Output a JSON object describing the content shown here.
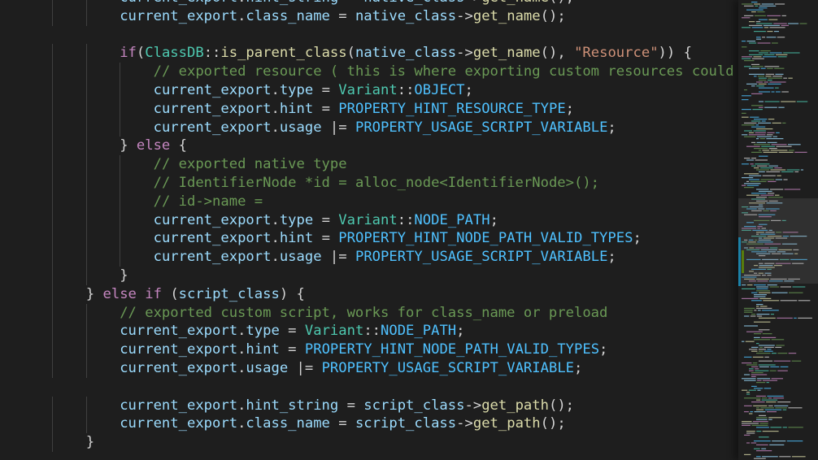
{
  "editor": {
    "language": "cpp",
    "colors": {
      "background": "#1e1e1e",
      "text": "#d4d4d4",
      "identifier": "#9cdcfe",
      "keyword": "#c586c0",
      "type": "#4ec9b0",
      "constant": "#4fc1ff",
      "function": "#dcdcaa",
      "string": "#ce9178",
      "comment": "#6a9955",
      "indent_guide": "#404040",
      "git_modified": "#1b81a8",
      "git_added": "#587c0c"
    },
    "lines": [
      {
        "indent": 3,
        "tokens": [
          {
            "t": "current_export",
            "c": "identifier"
          },
          {
            "t": ".",
            "c": "text"
          },
          {
            "t": "hint_string",
            "c": "identifier"
          },
          {
            "t": " = ",
            "c": "text"
          },
          {
            "t": "native_class",
            "c": "identifier"
          },
          {
            "t": "->",
            "c": "text"
          },
          {
            "t": "get_name",
            "c": "function"
          },
          {
            "t": "();",
            "c": "text"
          }
        ]
      },
      {
        "indent": 3,
        "tokens": [
          {
            "t": "current_export",
            "c": "identifier"
          },
          {
            "t": ".",
            "c": "text"
          },
          {
            "t": "class_name",
            "c": "identifier"
          },
          {
            "t": " = ",
            "c": "text"
          },
          {
            "t": "native_class",
            "c": "identifier"
          },
          {
            "t": "->",
            "c": "text"
          },
          {
            "t": "get_name",
            "c": "function"
          },
          {
            "t": "();",
            "c": "text"
          }
        ]
      },
      {
        "indent": 0,
        "tokens": []
      },
      {
        "indent": 3,
        "tokens": [
          {
            "t": "if",
            "c": "keyword"
          },
          {
            "t": "(",
            "c": "text"
          },
          {
            "t": "ClassDB",
            "c": "type"
          },
          {
            "t": "::",
            "c": "text"
          },
          {
            "t": "is_parent_class",
            "c": "function"
          },
          {
            "t": "(",
            "c": "text"
          },
          {
            "t": "native_class",
            "c": "identifier"
          },
          {
            "t": "->",
            "c": "text"
          },
          {
            "t": "get_name",
            "c": "function"
          },
          {
            "t": "(), ",
            "c": "text"
          },
          {
            "t": "\"Resource\"",
            "c": "string"
          },
          {
            "t": ")) {",
            "c": "text"
          }
        ]
      },
      {
        "indent": 4,
        "tokens": [
          {
            "t": "// exported resource ( this is where exporting custom resources could be",
            "c": "comment"
          }
        ]
      },
      {
        "indent": 4,
        "tokens": [
          {
            "t": "current_export",
            "c": "identifier"
          },
          {
            "t": ".",
            "c": "text"
          },
          {
            "t": "type",
            "c": "identifier"
          },
          {
            "t": " = ",
            "c": "text"
          },
          {
            "t": "Variant",
            "c": "type"
          },
          {
            "t": "::",
            "c": "text"
          },
          {
            "t": "OBJECT",
            "c": "constant"
          },
          {
            "t": ";",
            "c": "text"
          }
        ]
      },
      {
        "indent": 4,
        "tokens": [
          {
            "t": "current_export",
            "c": "identifier"
          },
          {
            "t": ".",
            "c": "text"
          },
          {
            "t": "hint",
            "c": "identifier"
          },
          {
            "t": " = ",
            "c": "text"
          },
          {
            "t": "PROPERTY_HINT_RESOURCE_TYPE",
            "c": "constant"
          },
          {
            "t": ";",
            "c": "text"
          }
        ]
      },
      {
        "indent": 4,
        "tokens": [
          {
            "t": "current_export",
            "c": "identifier"
          },
          {
            "t": ".",
            "c": "text"
          },
          {
            "t": "usage",
            "c": "identifier"
          },
          {
            "t": " |= ",
            "c": "text"
          },
          {
            "t": "PROPERTY_USAGE_SCRIPT_VARIABLE",
            "c": "constant"
          },
          {
            "t": ";",
            "c": "text"
          }
        ]
      },
      {
        "indent": 3,
        "tokens": [
          {
            "t": "} ",
            "c": "text"
          },
          {
            "t": "else",
            "c": "keyword"
          },
          {
            "t": " {",
            "c": "text"
          }
        ]
      },
      {
        "indent": 4,
        "tokens": [
          {
            "t": "// exported native type",
            "c": "comment"
          }
        ]
      },
      {
        "indent": 4,
        "tokens": [
          {
            "t": "// IdentifierNode *id = alloc_node<IdentifierNode>();",
            "c": "comment"
          }
        ]
      },
      {
        "indent": 4,
        "tokens": [
          {
            "t": "// id->name =",
            "c": "comment"
          }
        ]
      },
      {
        "indent": 4,
        "tokens": [
          {
            "t": "current_export",
            "c": "identifier"
          },
          {
            "t": ".",
            "c": "text"
          },
          {
            "t": "type",
            "c": "identifier"
          },
          {
            "t": " = ",
            "c": "text"
          },
          {
            "t": "Variant",
            "c": "type"
          },
          {
            "t": "::",
            "c": "text"
          },
          {
            "t": "NODE_PATH",
            "c": "constant"
          },
          {
            "t": ";",
            "c": "text"
          }
        ]
      },
      {
        "indent": 4,
        "tokens": [
          {
            "t": "current_export",
            "c": "identifier"
          },
          {
            "t": ".",
            "c": "text"
          },
          {
            "t": "hint",
            "c": "identifier"
          },
          {
            "t": " = ",
            "c": "text"
          },
          {
            "t": "PROPERTY_HINT_NODE_PATH_VALID_TYPES",
            "c": "constant"
          },
          {
            "t": ";",
            "c": "text"
          }
        ]
      },
      {
        "indent": 4,
        "tokens": [
          {
            "t": "current_export",
            "c": "identifier"
          },
          {
            "t": ".",
            "c": "text"
          },
          {
            "t": "usage",
            "c": "identifier"
          },
          {
            "t": " |= ",
            "c": "text"
          },
          {
            "t": "PROPERTY_USAGE_SCRIPT_VARIABLE",
            "c": "constant"
          },
          {
            "t": ";",
            "c": "text"
          }
        ]
      },
      {
        "indent": 3,
        "tokens": [
          {
            "t": "}",
            "c": "text"
          }
        ]
      },
      {
        "indent": 2,
        "tokens": [
          {
            "t": "} ",
            "c": "text"
          },
          {
            "t": "else",
            "c": "keyword"
          },
          {
            "t": " ",
            "c": "text"
          },
          {
            "t": "if",
            "c": "keyword"
          },
          {
            "t": " (",
            "c": "text"
          },
          {
            "t": "script_class",
            "c": "identifier"
          },
          {
            "t": ") {",
            "c": "text"
          }
        ]
      },
      {
        "indent": 3,
        "tokens": [
          {
            "t": "// exported custom script, works for class_name or preload",
            "c": "comment"
          }
        ]
      },
      {
        "indent": 3,
        "tokens": [
          {
            "t": "current_export",
            "c": "identifier"
          },
          {
            "t": ".",
            "c": "text"
          },
          {
            "t": "type",
            "c": "identifier"
          },
          {
            "t": " = ",
            "c": "text"
          },
          {
            "t": "Variant",
            "c": "type"
          },
          {
            "t": "::",
            "c": "text"
          },
          {
            "t": "NODE_PATH",
            "c": "constant"
          },
          {
            "t": ";",
            "c": "text"
          }
        ]
      },
      {
        "indent": 3,
        "tokens": [
          {
            "t": "current_export",
            "c": "identifier"
          },
          {
            "t": ".",
            "c": "text"
          },
          {
            "t": "hint",
            "c": "identifier"
          },
          {
            "t": " = ",
            "c": "text"
          },
          {
            "t": "PROPERTY_HINT_NODE_PATH_VALID_TYPES",
            "c": "constant"
          },
          {
            "t": ";",
            "c": "text"
          }
        ]
      },
      {
        "indent": 3,
        "tokens": [
          {
            "t": "current_export",
            "c": "identifier"
          },
          {
            "t": ".",
            "c": "text"
          },
          {
            "t": "usage",
            "c": "identifier"
          },
          {
            "t": " |= ",
            "c": "text"
          },
          {
            "t": "PROPERTY_USAGE_SCRIPT_VARIABLE",
            "c": "constant"
          },
          {
            "t": ";",
            "c": "text"
          }
        ]
      },
      {
        "indent": 0,
        "tokens": []
      },
      {
        "indent": 3,
        "tokens": [
          {
            "t": "current_export",
            "c": "identifier"
          },
          {
            "t": ".",
            "c": "text"
          },
          {
            "t": "hint_string",
            "c": "identifier"
          },
          {
            "t": " = ",
            "c": "text"
          },
          {
            "t": "script_class",
            "c": "identifier"
          },
          {
            "t": "->",
            "c": "text"
          },
          {
            "t": "get_path",
            "c": "function"
          },
          {
            "t": "();",
            "c": "text"
          }
        ]
      },
      {
        "indent": 3,
        "tokens": [
          {
            "t": "current_export",
            "c": "identifier"
          },
          {
            "t": ".",
            "c": "text"
          },
          {
            "t": "class_name",
            "c": "identifier"
          },
          {
            "t": " = ",
            "c": "text"
          },
          {
            "t": "script_class",
            "c": "identifier"
          },
          {
            "t": "->",
            "c": "text"
          },
          {
            "t": "get_path",
            "c": "function"
          },
          {
            "t": "();",
            "c": "text"
          }
        ]
      },
      {
        "indent": 2,
        "tokens": [
          {
            "t": "}",
            "c": "text"
          }
        ]
      }
    ]
  },
  "minimap": {
    "visible_region": "middle",
    "icon": "minimap-preview"
  }
}
